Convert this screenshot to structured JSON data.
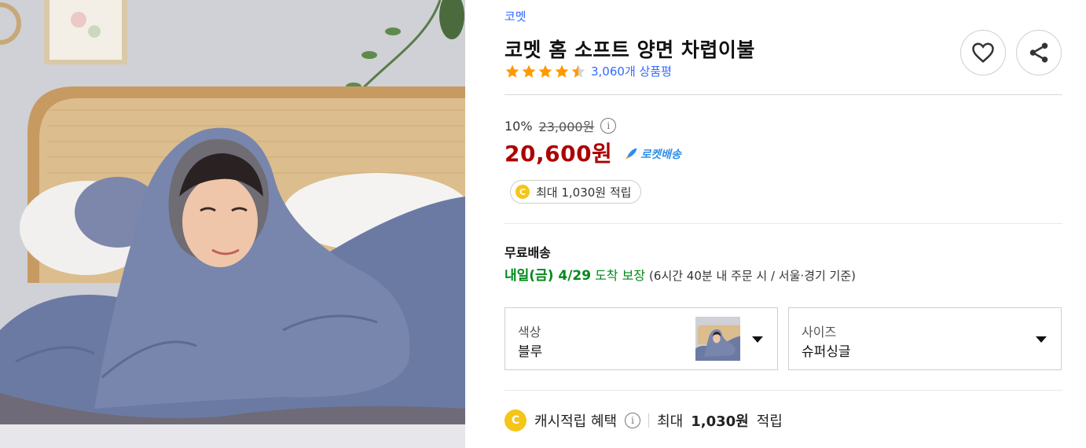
{
  "product": {
    "brand": "코멧",
    "title": "코멧 홈 소프트 양면 차렵이불",
    "rating": 4.5,
    "review_count": "3,060개 상품평"
  },
  "actions": {
    "wishlist_icon": "heart-icon",
    "share_icon": "share-icon"
  },
  "price": {
    "discount_rate": "10%",
    "original_price": "23,000원",
    "info_glyph": "i",
    "sale_price": "20,600원",
    "delivery_badge": "로켓배송",
    "cash_glyph": "C",
    "cash_pill": "최대 1,030원 적립"
  },
  "shipping": {
    "label": "무료배송",
    "arrival_date": "내일(금) 4/29",
    "arrival_guarantee": "도착 보장",
    "arrival_note": "(6시간 40분  내 주문 시 / 서울·경기 기준)"
  },
  "options": {
    "color_label": "색상",
    "color_value": "블루",
    "size_label": "사이즈",
    "size_value": "슈퍼싱글"
  },
  "benefit": {
    "label": "캐시적립 혜택",
    "info_glyph": "i",
    "prefix": "최대",
    "amount": "1,030원",
    "suffix": "적립"
  },
  "colors": {
    "accent_blue": "#346aff",
    "price_red": "#ae0000",
    "arrival_green": "#00891a",
    "coin_yellow": "#f5c518"
  }
}
